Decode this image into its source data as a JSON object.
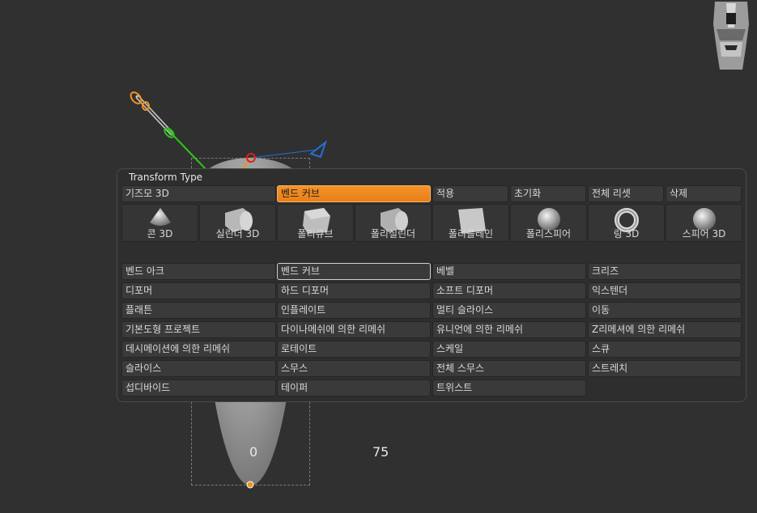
{
  "viewport": {
    "label_left": "0",
    "label_right": "75"
  },
  "palette": {
    "title": "Transform Type",
    "top_row": [
      {
        "label": "기즈모 3D",
        "state": "normal"
      },
      {
        "label": "벤드 커브",
        "state": "active"
      },
      {
        "label": "적용",
        "state": "normal"
      },
      {
        "label": "초기화",
        "state": "normal"
      },
      {
        "label": "전체 리셋",
        "state": "normal"
      },
      {
        "label": "삭제",
        "state": "normal"
      }
    ],
    "primitives": [
      {
        "label": "콘 3D",
        "icon": "cone-icon"
      },
      {
        "label": "실린더 3D",
        "icon": "cylinder-icon"
      },
      {
        "label": "폴리큐브",
        "icon": "polycube-icon"
      },
      {
        "label": "폴리실린더",
        "icon": "polycylinder-icon"
      },
      {
        "label": "폴리플레인",
        "icon": "polyplane-icon"
      },
      {
        "label": "폴리스피어",
        "icon": "polysphere-icon"
      },
      {
        "label": "링 3D",
        "icon": "ring-icon"
      },
      {
        "label": "스피어 3D",
        "icon": "sphere-icon"
      }
    ],
    "deformers": [
      [
        "벤드 아크",
        "벤드 커브",
        "베벨",
        "크리즈"
      ],
      [
        "디포머",
        "하드 디포머",
        "소프트 디포머",
        "익스텐더"
      ],
      [
        "플래튼",
        "인플레이트",
        "멀티 슬라이스",
        "이동"
      ],
      [
        "기본도형 프로젝트",
        "다이나메쉬에 의한 리메쉬",
        "유니언에 의한 리메쉬",
        "Z리메셔에 의한 리메쉬"
      ],
      [
        "데시메이션에 의한 리메쉬",
        "로테이트",
        "스케일",
        "스큐"
      ],
      [
        "슬라이스",
        "스무스",
        "전체 스무스",
        "스트레치"
      ],
      [
        "섭디바이드",
        "테이퍼",
        "트위스트",
        ""
      ]
    ],
    "selected_deformer": "벤드 커브"
  },
  "colors": {
    "accent": "#f08a24",
    "gizmo_orange": "#f0921e",
    "gizmo_green": "#2ec41a",
    "gizmo_blue": "#2470d8",
    "gizmo_red": "#e02020"
  }
}
